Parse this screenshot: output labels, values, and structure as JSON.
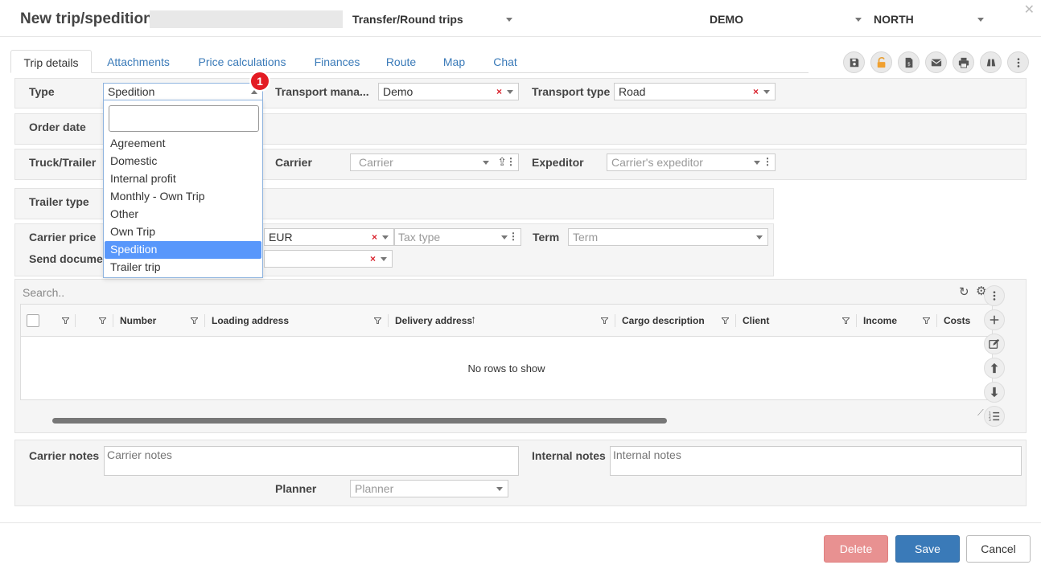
{
  "header": {
    "title": "New trip/spedition",
    "trip_kind": "Transfer/Round trips",
    "company": "DEMO",
    "region": "NORTH"
  },
  "tabs": [
    {
      "label": "Trip details"
    },
    {
      "label": "Attachments"
    },
    {
      "label": "Price calculations"
    },
    {
      "label": "Finances"
    },
    {
      "label": "Route"
    },
    {
      "label": "Map"
    },
    {
      "label": "Chat"
    }
  ],
  "toolbar_icons": [
    "save-icon",
    "unlock-icon",
    "document-dollar-icon",
    "envelope-icon",
    "printer-icon",
    "binoculars-icon",
    "more-vertical-icon"
  ],
  "form": {
    "type_label": "Type",
    "type_value": "Spedition",
    "transport_manager_label": "Transport mana...",
    "transport_manager_value": "Demo",
    "transport_type_label": "Transport type",
    "transport_type_value": "Road",
    "order_date_label": "Order date",
    "truck_trailer_label": "Truck/Trailer",
    "carrier_label": "Carrier",
    "carrier_placeholder": "Carrier",
    "expeditor_label": "Expeditor",
    "expeditor_placeholder": "Carrier's expeditor",
    "trailer_type_label": "Trailer type",
    "carrier_price_label": "Carrier price",
    "currency_value": "EUR",
    "tax_type_placeholder": "Tax type",
    "term_label": "Term",
    "term_placeholder": "Term",
    "send_documents_label": "Send documen"
  },
  "type_dropdown": {
    "badge": "1",
    "options": [
      "Agreement",
      "Domestic",
      "Internal profit",
      "Monthly - Own Trip",
      "Other",
      "Own Trip",
      "Spedition",
      "Trailer trip"
    ],
    "selected": "Spedition"
  },
  "grid": {
    "search_placeholder": "Search..",
    "columns": [
      "Number",
      "Loading address",
      "Delivery address",
      "Cargo description",
      "Client",
      "Income",
      "Costs"
    ],
    "sorted_column": "Delivery address",
    "empty_text": "No rows to show"
  },
  "notes": {
    "carrier_notes_label": "Carrier notes",
    "carrier_notes_placeholder": "Carrier notes",
    "internal_notes_label": "Internal notes",
    "internal_notes_placeholder": "Internal notes",
    "planner_label": "Planner",
    "planner_placeholder": "Planner"
  },
  "footer": {
    "delete_label": "Delete",
    "save_label": "Save",
    "cancel_label": "Cancel"
  },
  "colors": {
    "link": "#3a7ab8",
    "selected_option": "#5897fb",
    "save_button": "#3a7ab8",
    "delete_button": "#e89191",
    "badge": "#e31b23"
  }
}
